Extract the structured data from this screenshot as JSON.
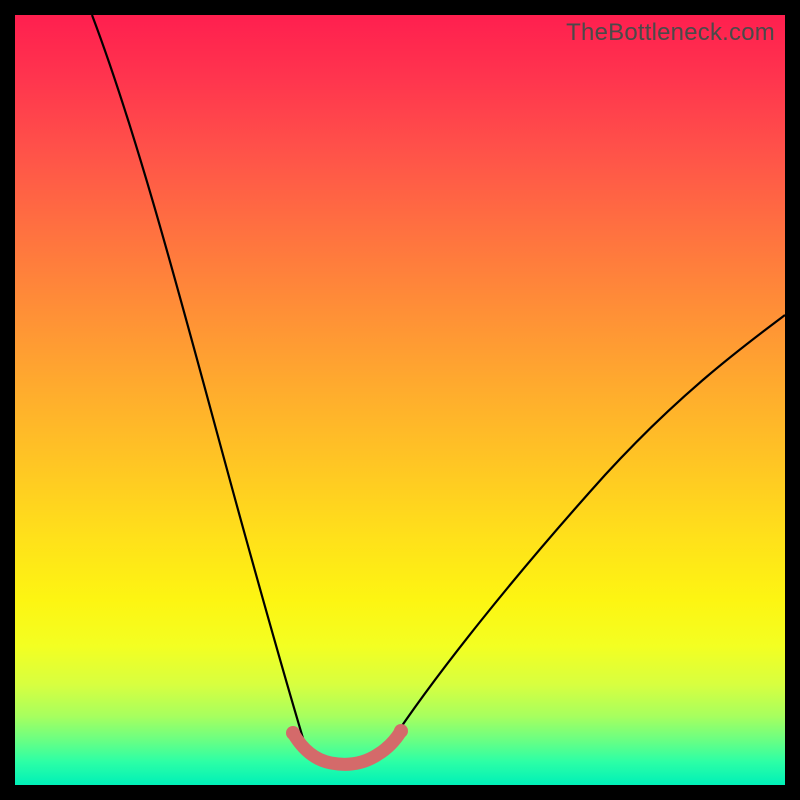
{
  "watermark": "TheBottleneck.com",
  "colors": {
    "background": "#000000",
    "curve_stroke": "#000000",
    "trough_stroke": "#d46a6a",
    "gradient_top": "#ff1f4f",
    "gradient_bottom": "#00f0b8"
  },
  "chart_data": {
    "type": "line",
    "title": "",
    "xlabel": "",
    "ylabel": "",
    "xlim": [
      0,
      100
    ],
    "ylim": [
      0,
      100
    ],
    "grid": false,
    "legend": false,
    "description": "Bottleneck-style V-curve: two thin black curves descend from opposite top edges into a flat trough near the bottom; the trough region is overlaid with a thicker salmon-colored segment.",
    "series": [
      {
        "name": "left-curve",
        "x": [
          10,
          13,
          16,
          19,
          22,
          25,
          28,
          31,
          34,
          36,
          37.5
        ],
        "y": [
          100,
          90,
          78,
          65,
          52,
          40,
          29,
          19,
          11,
          6,
          5
        ]
      },
      {
        "name": "trough",
        "x": [
          37.5,
          39,
          41,
          43,
          45,
          47,
          48.5
        ],
        "y": [
          5,
          4,
          3.5,
          3.5,
          3.7,
          4.2,
          5
        ]
      },
      {
        "name": "right-curve",
        "x": [
          48.5,
          52,
          57,
          63,
          70,
          78,
          86,
          94,
          100
        ],
        "y": [
          5,
          8,
          13,
          20,
          28,
          37,
          46,
          54,
          60
        ]
      },
      {
        "name": "trough-highlight",
        "stroke": "#d46a6a",
        "stroke_width_px": 12,
        "x": [
          36,
          37,
          38.5,
          40,
          42,
          44,
          46,
          47.5,
          49,
          50
        ],
        "y": [
          7,
          5.5,
          4.3,
          3.8,
          3.5,
          3.6,
          4,
          4.6,
          5.6,
          7
        ]
      }
    ]
  }
}
